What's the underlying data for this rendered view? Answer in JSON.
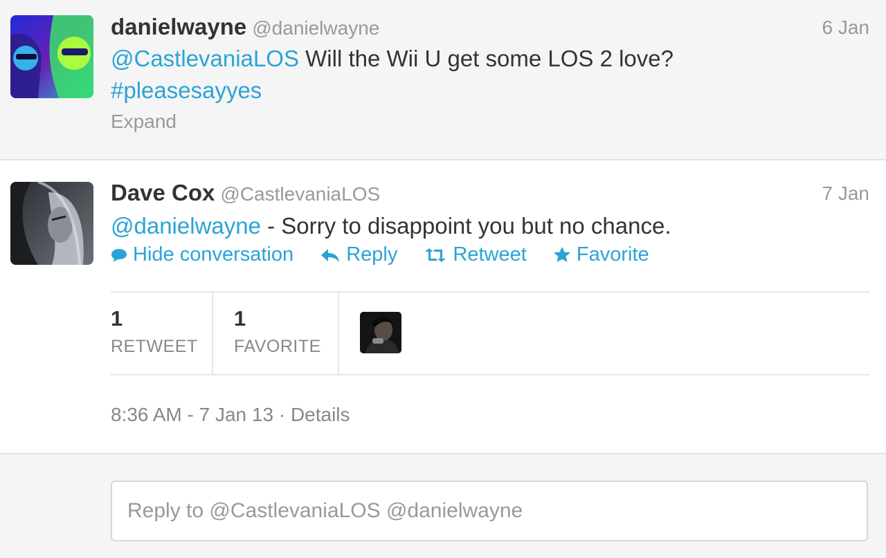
{
  "tweets": [
    {
      "display_name": "danielwayne",
      "handle": "@danielwayne",
      "date": "6 Jan",
      "mention": "@CastlevaniaLOS",
      "text": "Will the Wii U get some LOS 2 love?",
      "hashtag": "#pleasesayyes",
      "expand_label": "Expand"
    },
    {
      "display_name": "Dave Cox",
      "handle": "@CastlevaniaLOS",
      "date": "7 Jan",
      "mention": "@danielwayne",
      "text": "- Sorry to disappoint you but no chance.",
      "actions": {
        "hide_conversation": "Hide conversation",
        "reply": "Reply",
        "retweet": "Retweet",
        "favorite": "Favorite"
      },
      "stats": {
        "retweet_count": "1",
        "retweet_label": "RETWEET",
        "favorite_count": "1",
        "favorite_label": "FAVORITE"
      },
      "timestamp": "8:36 AM - 7 Jan 13",
      "details_label": "Details"
    }
  ],
  "reply_box": {
    "placeholder": "Reply to @CastlevaniaLOS @danielwayne"
  },
  "colors": {
    "link": "#2aa3d6",
    "text": "#333333",
    "muted": "#999999",
    "background": "#f5f5f5"
  }
}
